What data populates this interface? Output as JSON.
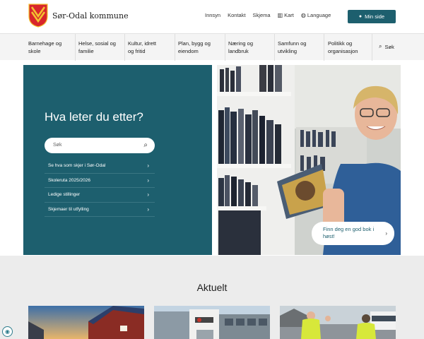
{
  "header": {
    "brand": "Sør-Odal kommune",
    "links": [
      {
        "label": "Innsyn",
        "icon": ""
      },
      {
        "label": "Kontakt",
        "icon": ""
      },
      {
        "label": "Skjema",
        "icon": ""
      },
      {
        "label": "Kart",
        "icon": "map-icon"
      },
      {
        "label": "Language",
        "icon": "globe-icon"
      }
    ],
    "min_side_label": "Min side"
  },
  "nav": {
    "items": [
      {
        "line1": "Barnehage og",
        "line2": "skole"
      },
      {
        "line1": "Helse, sosial og",
        "line2": "familie"
      },
      {
        "line1": "Kultur, idrett",
        "line2": "og fritid"
      },
      {
        "line1": "Plan, bygg og",
        "line2": "eiendom"
      },
      {
        "line1": "Næring og",
        "line2": "landbruk"
      },
      {
        "line1": "Samfunn og",
        "line2": "utvikling"
      },
      {
        "line1": "Politikk og",
        "line2": "organisasjon"
      }
    ],
    "search_label": "Søk"
  },
  "hero": {
    "title": "Hva leter du etter?",
    "search_placeholder": "Søk",
    "quicklinks": [
      "Se hva som skjer i Sør-Odal",
      "Skoleruta 2025/2026",
      "Ledige stillinger",
      "Skjemaer til utfylling"
    ],
    "cta_line1": "Finn deg en god bok i",
    "cta_line2": "høst!"
  },
  "aktuelt": {
    "title": "Aktuelt"
  },
  "colors": {
    "brand": "#1d5f6e",
    "nav_bg": "#f4f4f4",
    "section_bg": "#ececec"
  }
}
